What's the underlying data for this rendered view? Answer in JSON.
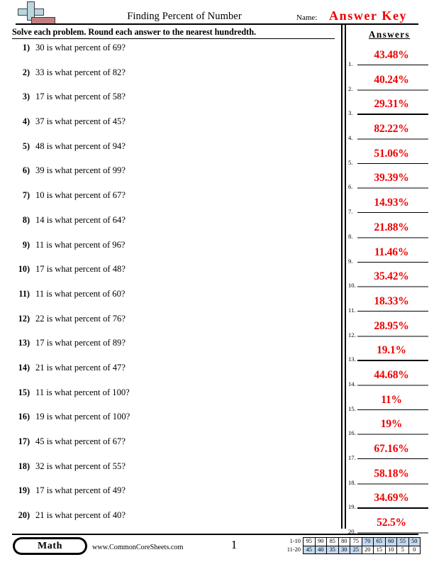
{
  "header": {
    "title": "Finding Percent of Number",
    "name_label": "Name:",
    "answer_key": "Answer Key",
    "logo_icon": "math-plus-logo-icon",
    "logo_plus_color": "#b9d7dc",
    "logo_bar_color": "#c08080"
  },
  "instructions": "Solve each problem. Round each answer to the nearest hundredth.",
  "answers_panel": {
    "heading": "Answers",
    "answer_color": "#ee0000"
  },
  "problems": [
    {
      "number": "1)",
      "text": "30 is what percent of 69?"
    },
    {
      "number": "2)",
      "text": "33 is what percent of 82?"
    },
    {
      "number": "3)",
      "text": "17 is what percent of 58?"
    },
    {
      "number": "4)",
      "text": "37 is what percent of 45?"
    },
    {
      "number": "5)",
      "text": "48 is what percent of 94?"
    },
    {
      "number": "6)",
      "text": "39 is what percent of 99?"
    },
    {
      "number": "7)",
      "text": "10 is what percent of 67?"
    },
    {
      "number": "8)",
      "text": "14 is what percent of 64?"
    },
    {
      "number": "9)",
      "text": "11 is what percent of 96?"
    },
    {
      "number": "10)",
      "text": "17 is what percent of 48?"
    },
    {
      "number": "11)",
      "text": "11 is what percent of 60?"
    },
    {
      "number": "12)",
      "text": "22 is what percent of 76?"
    },
    {
      "number": "13)",
      "text": "17 is what percent of 89?"
    },
    {
      "number": "14)",
      "text": "21 is what percent of 47?"
    },
    {
      "number": "15)",
      "text": "11 is what percent of 100?"
    },
    {
      "number": "16)",
      "text": "19 is what percent of 100?"
    },
    {
      "number": "17)",
      "text": "45 is what percent of 67?"
    },
    {
      "number": "18)",
      "text": "32 is what percent of 55?"
    },
    {
      "number": "19)",
      "text": "17 is what percent of 49?"
    },
    {
      "number": "20)",
      "text": "21 is what percent of 40?"
    }
  ],
  "answers": [
    {
      "index": "1.",
      "value": "43.48%"
    },
    {
      "index": "2.",
      "value": "40.24%"
    },
    {
      "index": "3.",
      "value": "29.31%"
    },
    {
      "index": "4.",
      "value": "82.22%"
    },
    {
      "index": "5.",
      "value": "51.06%"
    },
    {
      "index": "6.",
      "value": "39.39%"
    },
    {
      "index": "7.",
      "value": "14.93%"
    },
    {
      "index": "8.",
      "value": "21.88%"
    },
    {
      "index": "9.",
      "value": "11.46%"
    },
    {
      "index": "10.",
      "value": "35.42%"
    },
    {
      "index": "11.",
      "value": "18.33%"
    },
    {
      "index": "12.",
      "value": "28.95%"
    },
    {
      "index": "13.",
      "value": "19.1%"
    },
    {
      "index": "14.",
      "value": "44.68%"
    },
    {
      "index": "15.",
      "value": "11%"
    },
    {
      "index": "16.",
      "value": "19%"
    },
    {
      "index": "17.",
      "value": "67.16%"
    },
    {
      "index": "18.",
      "value": "58.18%"
    },
    {
      "index": "19.",
      "value": "34.69%"
    },
    {
      "index": "20.",
      "value": "52.5%"
    }
  ],
  "footer": {
    "subject_badge": "Math",
    "site_url": "www.CommonCoreSheets.com",
    "page_number": "1",
    "score_table": {
      "highlight_color": "#c3d9f0",
      "rows": [
        {
          "label": "1-10",
          "cells": [
            {
              "value": "95",
              "highlighted": false
            },
            {
              "value": "90",
              "highlighted": false
            },
            {
              "value": "85",
              "highlighted": false
            },
            {
              "value": "80",
              "highlighted": false
            },
            {
              "value": "75",
              "highlighted": false
            },
            {
              "value": "70",
              "highlighted": true
            },
            {
              "value": "65",
              "highlighted": true
            },
            {
              "value": "60",
              "highlighted": true
            },
            {
              "value": "55",
              "highlighted": true
            },
            {
              "value": "50",
              "highlighted": true
            }
          ]
        },
        {
          "label": "11-20",
          "cells": [
            {
              "value": "45",
              "highlighted": true
            },
            {
              "value": "40",
              "highlighted": true
            },
            {
              "value": "35",
              "highlighted": true
            },
            {
              "value": "30",
              "highlighted": true
            },
            {
              "value": "25",
              "highlighted": true
            },
            {
              "value": "20",
              "highlighted": false
            },
            {
              "value": "15",
              "highlighted": false
            },
            {
              "value": "10",
              "highlighted": false
            },
            {
              "value": "5",
              "highlighted": false
            },
            {
              "value": "0",
              "highlighted": false
            }
          ]
        }
      ]
    }
  }
}
